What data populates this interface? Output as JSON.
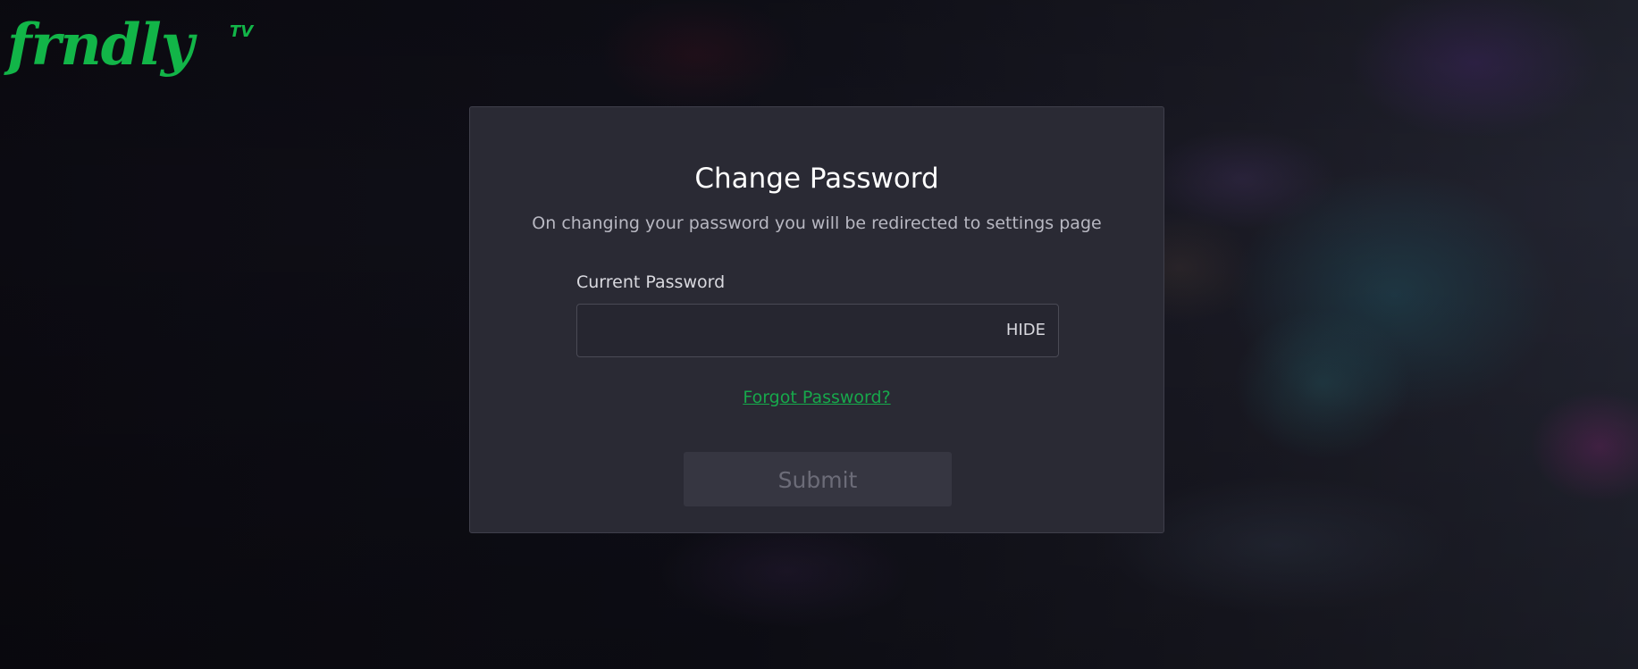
{
  "brand": {
    "logo_text": "frndly",
    "logo_superscript": "TV",
    "brand_color": "#12b548"
  },
  "change_password": {
    "title": "Change Password",
    "subtitle": "On changing your password you will be redirected to settings page",
    "current_password_label": "Current Password",
    "current_password_value": "",
    "visibility_toggle_label": "HIDE",
    "forgot_password_link": "Forgot Password?",
    "submit_label": "Submit"
  },
  "colors": {
    "accent_green": "#17a84b",
    "card_background": "#2a2a34",
    "disabled_button": "#363641"
  }
}
